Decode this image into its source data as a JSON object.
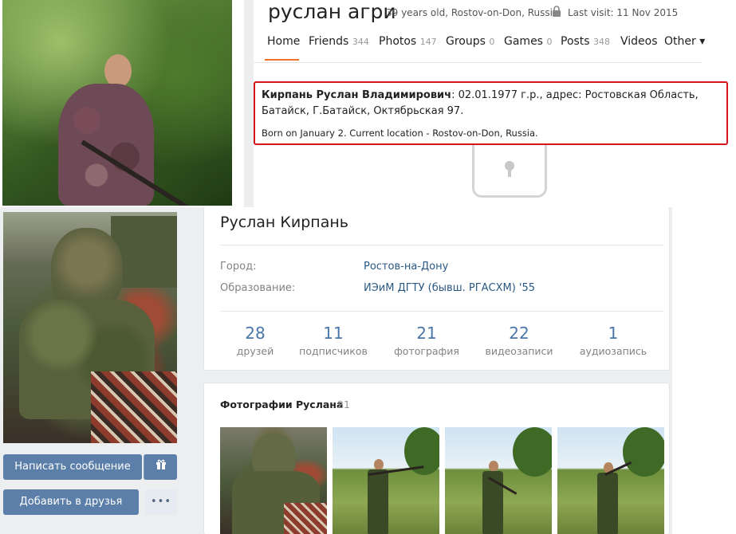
{
  "top_profile": {
    "name": "руслан агри",
    "meta": "39 years old, Rostov-on-Don, Russia",
    "last_visit": "Last visit: 11 Nov 2015",
    "nav": [
      {
        "label": "Home",
        "count": ""
      },
      {
        "label": "Friends",
        "count": "344"
      },
      {
        "label": "Photos",
        "count": "147"
      },
      {
        "label": "Groups",
        "count": "0"
      },
      {
        "label": "Games",
        "count": "0"
      },
      {
        "label": "Posts",
        "count": "348"
      },
      {
        "label": "Videos",
        "count": ""
      },
      {
        "label": "Other ▾",
        "count": ""
      }
    ],
    "info_bold": "Кирпань Руслан Владимирович",
    "info_rest": ": 02.01.1977 г.р., адрес: Ростовская Область, Батайск, Г.Батайск, Октябрьская 97.",
    "born": "Born on January 2. Current location - Rostov-on-Don, Russia.",
    "highlight_color": "#d6141c",
    "active_tab_color": "#f07028"
  },
  "vk_profile": {
    "name": "Руслан Кирпань",
    "rows": [
      {
        "label": "Город:",
        "value": "Ростов-на-Дону"
      },
      {
        "label": "Образование:",
        "value": "ИЭиМ ДГТУ (бывш. РГАСХМ) '55"
      }
    ],
    "stats": [
      {
        "number": "28",
        "label": "друзей"
      },
      {
        "number": "11",
        "label": "подписчиков"
      },
      {
        "number": "21",
        "label": "фотография"
      },
      {
        "number": "22",
        "label": "видеозаписи"
      },
      {
        "number": "1",
        "label": "аудиозапись"
      }
    ],
    "photos_title": "Фотографии Руслана",
    "photos_count": "21",
    "send_message": "Написать сообщение",
    "add_friend": "Добавить в друзья",
    "more": "•••",
    "gift_icon": "gift-icon",
    "accent_color": "#5b7fa8"
  }
}
